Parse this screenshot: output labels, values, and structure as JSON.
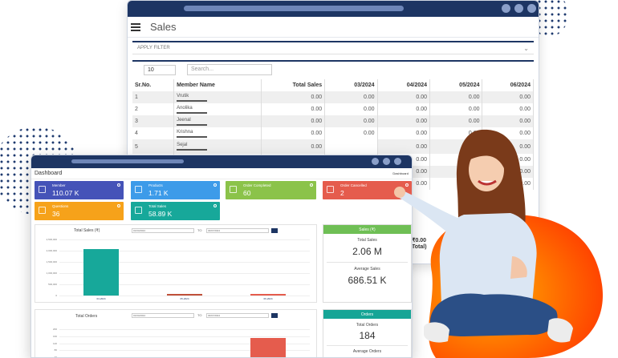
{
  "back_window": {
    "title": "Sales",
    "filter_label": "APPLY FILTER",
    "page_length": "10",
    "search_placeholder": "Search...",
    "columns": [
      "Sr.No.",
      "Member Name",
      "Total Sales",
      "03/2024",
      "04/2024",
      "05/2024",
      "06/2024"
    ],
    "rows": [
      {
        "sr": "1",
        "name": "Vrutik",
        "total": "0.00",
        "m3": "0.00",
        "m4": "0.00",
        "m5": "0.00",
        "m6": "0.00"
      },
      {
        "sr": "2",
        "name": "Anolika",
        "total": "0.00",
        "m3": "0.00",
        "m4": "0.00",
        "m5": "0.00",
        "m6": "0.00"
      },
      {
        "sr": "3",
        "name": "Jeenal",
        "total": "0.00",
        "m3": "0.00",
        "m4": "0.00",
        "m5": "0.00",
        "m6": "0.00"
      },
      {
        "sr": "4",
        "name": "Krishna",
        "total": "0.00",
        "m3": "0.00",
        "m4": "0.00",
        "m5": "0.00",
        "m6": "0.00"
      },
      {
        "sr": "5",
        "name": "Sejal",
        "total": "0.00",
        "m3": "",
        "m4": "0.00",
        "m5": "0.00",
        "m6": "0.00"
      }
    ],
    "footer_value": "₹0.00",
    "footer_label": "Total)"
  },
  "front_window": {
    "title": "Dashboard",
    "breadcrumb": "Dashboard",
    "cards": [
      {
        "label": "Member",
        "value": "110.07 K",
        "color": "#4553b8"
      },
      {
        "label": "Products",
        "value": "1.71 K",
        "color": "#3d9be9"
      },
      {
        "label": "Order Completed",
        "value": "60",
        "color": "#8bc34a"
      },
      {
        "label": "Order Cancelled",
        "value": "2",
        "color": "#e55c4d"
      },
      {
        "label": "Questions",
        "value": "36",
        "color": "#f6a21a"
      },
      {
        "label": "Total Sales",
        "value": "58.89 K",
        "color": "#17a89a"
      }
    ],
    "sales_chart": {
      "title": "Total Sales (₹)",
      "from_date": "01/04/2024",
      "to_label": "TO",
      "to_date": "30/07/2024"
    },
    "orders_chart": {
      "title": "Total Orders",
      "from_date": "01/04/2024",
      "to_label": "TO",
      "to_date": "30/07/2024"
    },
    "sales_summary": {
      "header": "Sales (₹)",
      "total_label": "Total Sales",
      "total_value": "2.06 M",
      "avg_label": "Average Sales",
      "avg_value": "686.51 K"
    },
    "orders_summary": {
      "header": "Orders",
      "total_label": "Total Orders",
      "total_value": "184",
      "avg_label": "Average Orders"
    }
  },
  "chart_data": [
    {
      "type": "bar",
      "title": "Total Sales (₹)",
      "categories": [
        "04-2024",
        "05-2024",
        "06-2024"
      ],
      "values": [
        2060000,
        40000,
        30000
      ],
      "ylim": [
        0,
        2500000
      ],
      "colors": [
        "#17a89a",
        "#c0503a",
        "#e55c4d"
      ]
    },
    {
      "type": "bar",
      "title": "Total Orders",
      "categories": [
        "04-2024",
        "05-2024",
        "06-2024"
      ],
      "values": [
        0,
        0,
        150
      ],
      "ylim": [
        0,
        200
      ],
      "colors": [
        "#17a89a",
        "#c0503a",
        "#e55c4d"
      ]
    }
  ]
}
